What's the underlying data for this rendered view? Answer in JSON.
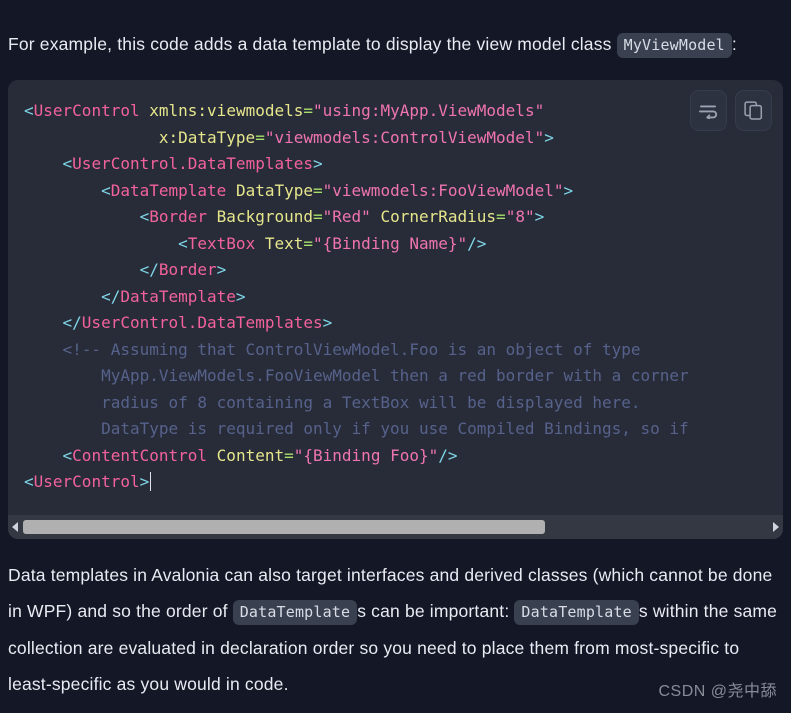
{
  "theme": {
    "page_bg": "#131726",
    "code_bg": "#282c38",
    "chip_bg": "#39404f",
    "text": "#e9ebf2",
    "tag_color": "#f3629c",
    "attr_color": "#e6e68c",
    "string_color": "#f074b0",
    "punct_color": "#7fd6e8",
    "comment_color": "#56628c",
    "scrollbar_thumb": "#b0b0b0",
    "scrollbar_track": "#343842"
  },
  "intro": {
    "text_before": "For example, this code adds a data template to display the view model class",
    "inline_code": "MyViewModel",
    "text_after": ":"
  },
  "code_block": {
    "language": "xaml",
    "actions": [
      {
        "name": "word-wrap",
        "label": "Toggle word wrap"
      },
      {
        "name": "copy",
        "label": "Copy code"
      }
    ],
    "scroll": {
      "orientation": "horizontal",
      "thumb_fraction": 0.7,
      "left_arrow": "◀",
      "right_arrow": "▶"
    },
    "caret_line": 13,
    "lines": [
      [
        {
          "t": "punct",
          "v": "<"
        },
        {
          "t": "tag",
          "v": "UserControl"
        },
        {
          "t": "plain",
          "v": " "
        },
        {
          "t": "attr",
          "v": "xmlns:viewmodels"
        },
        {
          "t": "eq",
          "v": "="
        },
        {
          "t": "str",
          "v": "\"using:MyApp.ViewModels\""
        }
      ],
      [
        {
          "t": "plain",
          "v": "              "
        },
        {
          "t": "attr",
          "v": "x:DataType"
        },
        {
          "t": "eq",
          "v": "="
        },
        {
          "t": "str",
          "v": "\"viewmodels:ControlViewModel\""
        },
        {
          "t": "punct",
          "v": ">"
        }
      ],
      [
        {
          "t": "plain",
          "v": "    "
        },
        {
          "t": "punct",
          "v": "<"
        },
        {
          "t": "tag",
          "v": "UserControl.DataTemplates"
        },
        {
          "t": "punct",
          "v": ">"
        }
      ],
      [
        {
          "t": "plain",
          "v": "        "
        },
        {
          "t": "punct",
          "v": "<"
        },
        {
          "t": "tag",
          "v": "DataTemplate"
        },
        {
          "t": "plain",
          "v": " "
        },
        {
          "t": "attr",
          "v": "DataType"
        },
        {
          "t": "eq",
          "v": "="
        },
        {
          "t": "str",
          "v": "\"viewmodels:FooViewModel\""
        },
        {
          "t": "punct",
          "v": ">"
        }
      ],
      [
        {
          "t": "plain",
          "v": "            "
        },
        {
          "t": "punct",
          "v": "<"
        },
        {
          "t": "tag",
          "v": "Border"
        },
        {
          "t": "plain",
          "v": " "
        },
        {
          "t": "attr",
          "v": "Background"
        },
        {
          "t": "eq",
          "v": "="
        },
        {
          "t": "str",
          "v": "\"Red\""
        },
        {
          "t": "plain",
          "v": " "
        },
        {
          "t": "attr",
          "v": "CornerRadius"
        },
        {
          "t": "eq",
          "v": "="
        },
        {
          "t": "str",
          "v": "\"8\""
        },
        {
          "t": "punct",
          "v": ">"
        }
      ],
      [
        {
          "t": "plain",
          "v": "                "
        },
        {
          "t": "punct",
          "v": "<"
        },
        {
          "t": "tag",
          "v": "TextBox"
        },
        {
          "t": "plain",
          "v": " "
        },
        {
          "t": "attr",
          "v": "Text"
        },
        {
          "t": "eq",
          "v": "="
        },
        {
          "t": "str",
          "v": "\"{Binding Name}\""
        },
        {
          "t": "punct",
          "v": "/>"
        }
      ],
      [
        {
          "t": "plain",
          "v": "            "
        },
        {
          "t": "punct",
          "v": "</"
        },
        {
          "t": "tag",
          "v": "Border"
        },
        {
          "t": "punct",
          "v": ">"
        }
      ],
      [
        {
          "t": "plain",
          "v": "        "
        },
        {
          "t": "punct",
          "v": "</"
        },
        {
          "t": "tag",
          "v": "DataTemplate"
        },
        {
          "t": "punct",
          "v": ">"
        }
      ],
      [
        {
          "t": "plain",
          "v": "    "
        },
        {
          "t": "punct",
          "v": "</"
        },
        {
          "t": "tag",
          "v": "UserControl.DataTemplates"
        },
        {
          "t": "punct",
          "v": ">"
        }
      ],
      [
        {
          "t": "plain",
          "v": "    "
        },
        {
          "t": "comment",
          "v": "<!-- Assuming that ControlViewModel.Foo is an object of type"
        }
      ],
      [
        {
          "t": "plain",
          "v": "        "
        },
        {
          "t": "comment",
          "v": "MyApp.ViewModels.FooViewModel then a red border with a corner"
        }
      ],
      [
        {
          "t": "plain",
          "v": "        "
        },
        {
          "t": "comment",
          "v": "radius of 8 containing a TextBox will be displayed here."
        }
      ],
      [
        {
          "t": "plain",
          "v": "        "
        },
        {
          "t": "comment",
          "v": "DataType is required only if you use Compiled Bindings, so if"
        }
      ],
      [
        {
          "t": "plain",
          "v": "    "
        },
        {
          "t": "punct",
          "v": "<"
        },
        {
          "t": "tag",
          "v": "ContentControl"
        },
        {
          "t": "plain",
          "v": " "
        },
        {
          "t": "attr",
          "v": "Content"
        },
        {
          "t": "eq",
          "v": "="
        },
        {
          "t": "str",
          "v": "\"{Binding Foo}\""
        },
        {
          "t": "punct",
          "v": "/>"
        }
      ],
      [
        {
          "t": "punct",
          "v": "<"
        },
        {
          "t": "tag",
          "v": "UserControl"
        },
        {
          "t": "punct",
          "v": ">"
        },
        {
          "t": "caret",
          "v": ""
        }
      ]
    ]
  },
  "outro": {
    "part1": "Data templates in Avalonia can also target interfaces and derived classes (which cannot be done in WPF) and so the order of ",
    "chip1": "DataTemplate",
    "part2": "s can be important: ",
    "chip2": "DataTemplate",
    "part3": "s within the same collection are evaluated in declaration order so you need to place them from most-specific to least-specific as you would in code."
  },
  "watermark": {
    "text": "CSDN @尧中舔"
  }
}
